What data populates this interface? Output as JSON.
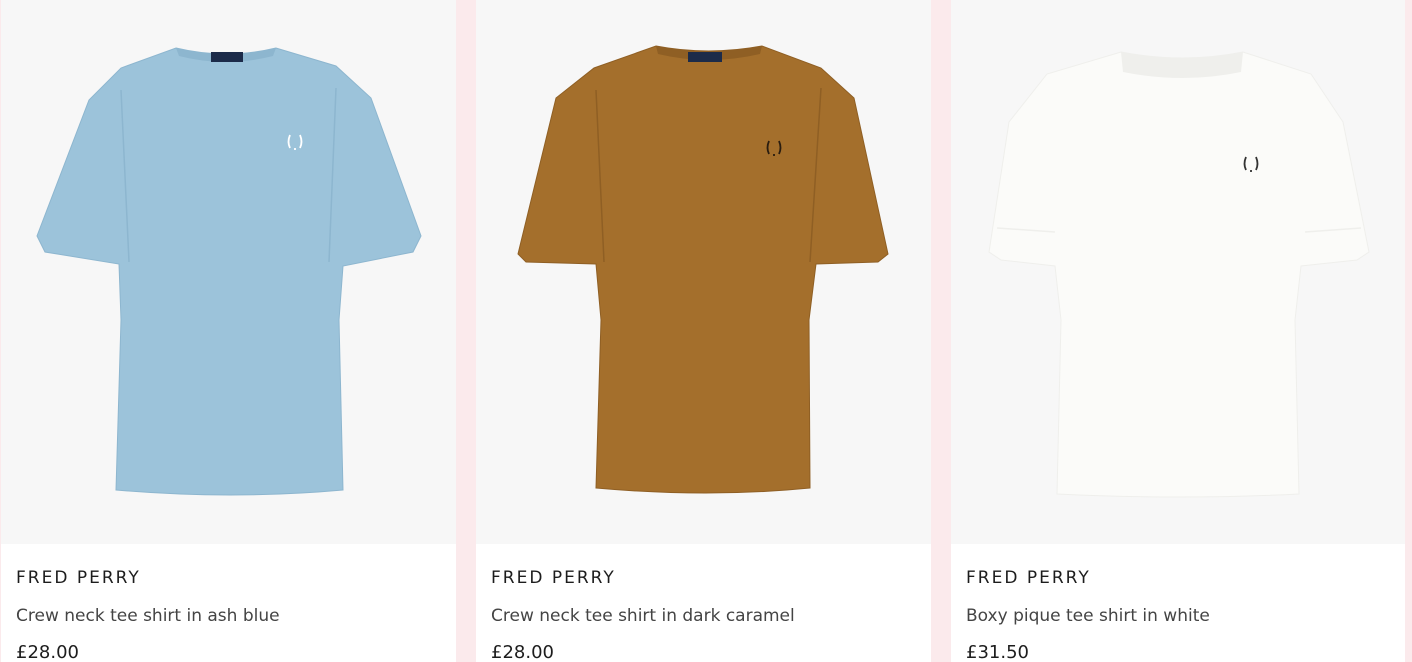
{
  "products": [
    {
      "brand": "FRED PERRY",
      "name": "Crew neck tee shirt in ash blue",
      "price": "£28.00",
      "shirt_color": "#9cc3da",
      "shirt_shade": "#8db6cf",
      "logo_color": "#ffffff",
      "icon": "tshirt-image"
    },
    {
      "brand": "FRED PERRY",
      "name": "Crew neck tee shirt in dark caramel",
      "price": "£28.00",
      "shirt_color": "#a46f2c",
      "shirt_shade": "#8f5f24",
      "logo_color": "#2a1d10",
      "icon": "tshirt-image"
    },
    {
      "brand": "FRED PERRY",
      "name": "Boxy pique tee shirt in white",
      "price": "£31.50",
      "shirt_color": "#fbfbf9",
      "shirt_shade": "#efefec",
      "logo_color": "#333333",
      "icon": "tshirt-image"
    }
  ],
  "colors": {
    "page_background": "#fbeaec",
    "image_background": "#f7f7f7"
  }
}
